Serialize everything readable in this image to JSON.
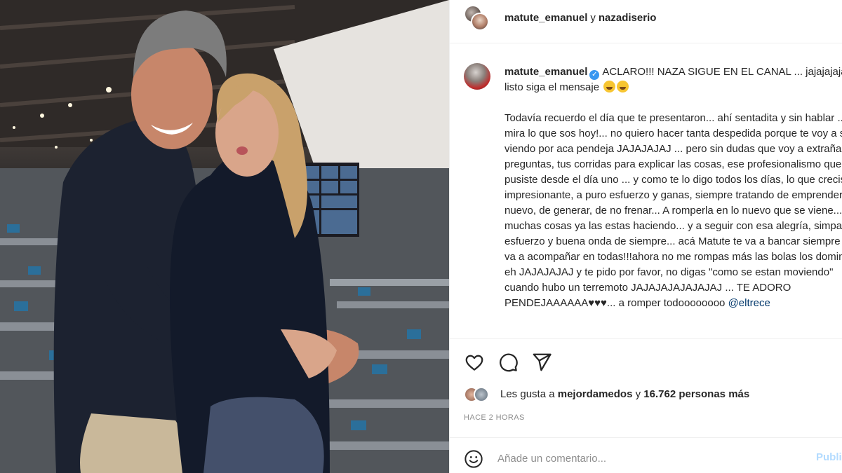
{
  "header": {
    "user1": "matute_emanuel",
    "separator": "y",
    "user2": "nazadiserio"
  },
  "caption": {
    "username": "matute_emanuel",
    "verified_icon": "verified-badge-icon",
    "intro": "ACLARO!!! NAZA SIGUE EN EL CANAL ... jajajajaja.... listo siga el mensaje",
    "body": "Todavía recuerdo el día que te presentaron... ahí sentadita y sin hablar ... y mira lo que sos hoy!... no quiero hacer tanta despedida porque te voy a seguir viendo por aca pendeja JAJAJAJAJ ... pero sin dudas que voy a extrañar tus preguntas, tus corridas para explicar las cosas, ese profesionalismo que le pusiste desde el día uno ... y como te lo digo todos los días, lo que creciste es impresionante, a puro esfuerzo y ganas, siempre tratando de emprender algo nuevo, de generar, de no frenar... A romperla en lo nuevo que se viene... muchas cosas ya las estas haciendo... y a seguir con esa alegría, simpatía, esfuerzo y buena onda de siempre... acá Matute te va a bancar siempre y te va a acompañar en todas!!!ahora no me rompas más las bolas los domingos eh JAJAJAJAJ y te pido por favor, no digas \"como se estan moviendo\" cuando hubo un terremoto JAJAJAJAJAJAJAJ ... TE ADORO PENDEJAAAAAA♥♥♥... a romper todoooooooo",
    "mention": "@eltrece"
  },
  "actions": {
    "like_icon": "heart-icon",
    "comment_icon": "comment-icon",
    "share_icon": "paper-plane-icon"
  },
  "likes": {
    "prefix": "Les gusta a",
    "user": "mejordamedos",
    "connector": "y",
    "count": "16.762 personas más"
  },
  "timestamp": "HACE 2 HORAS",
  "comment": {
    "placeholder": "Añade un comentario...",
    "emoji_icon": "smiley-icon",
    "publish_label": "Publicar"
  },
  "colors": {
    "link": "#00376b",
    "verified": "#3897f0",
    "publish_disabled": "#b3dbff",
    "muted": "#8e8e8e",
    "divider": "#efefef"
  }
}
